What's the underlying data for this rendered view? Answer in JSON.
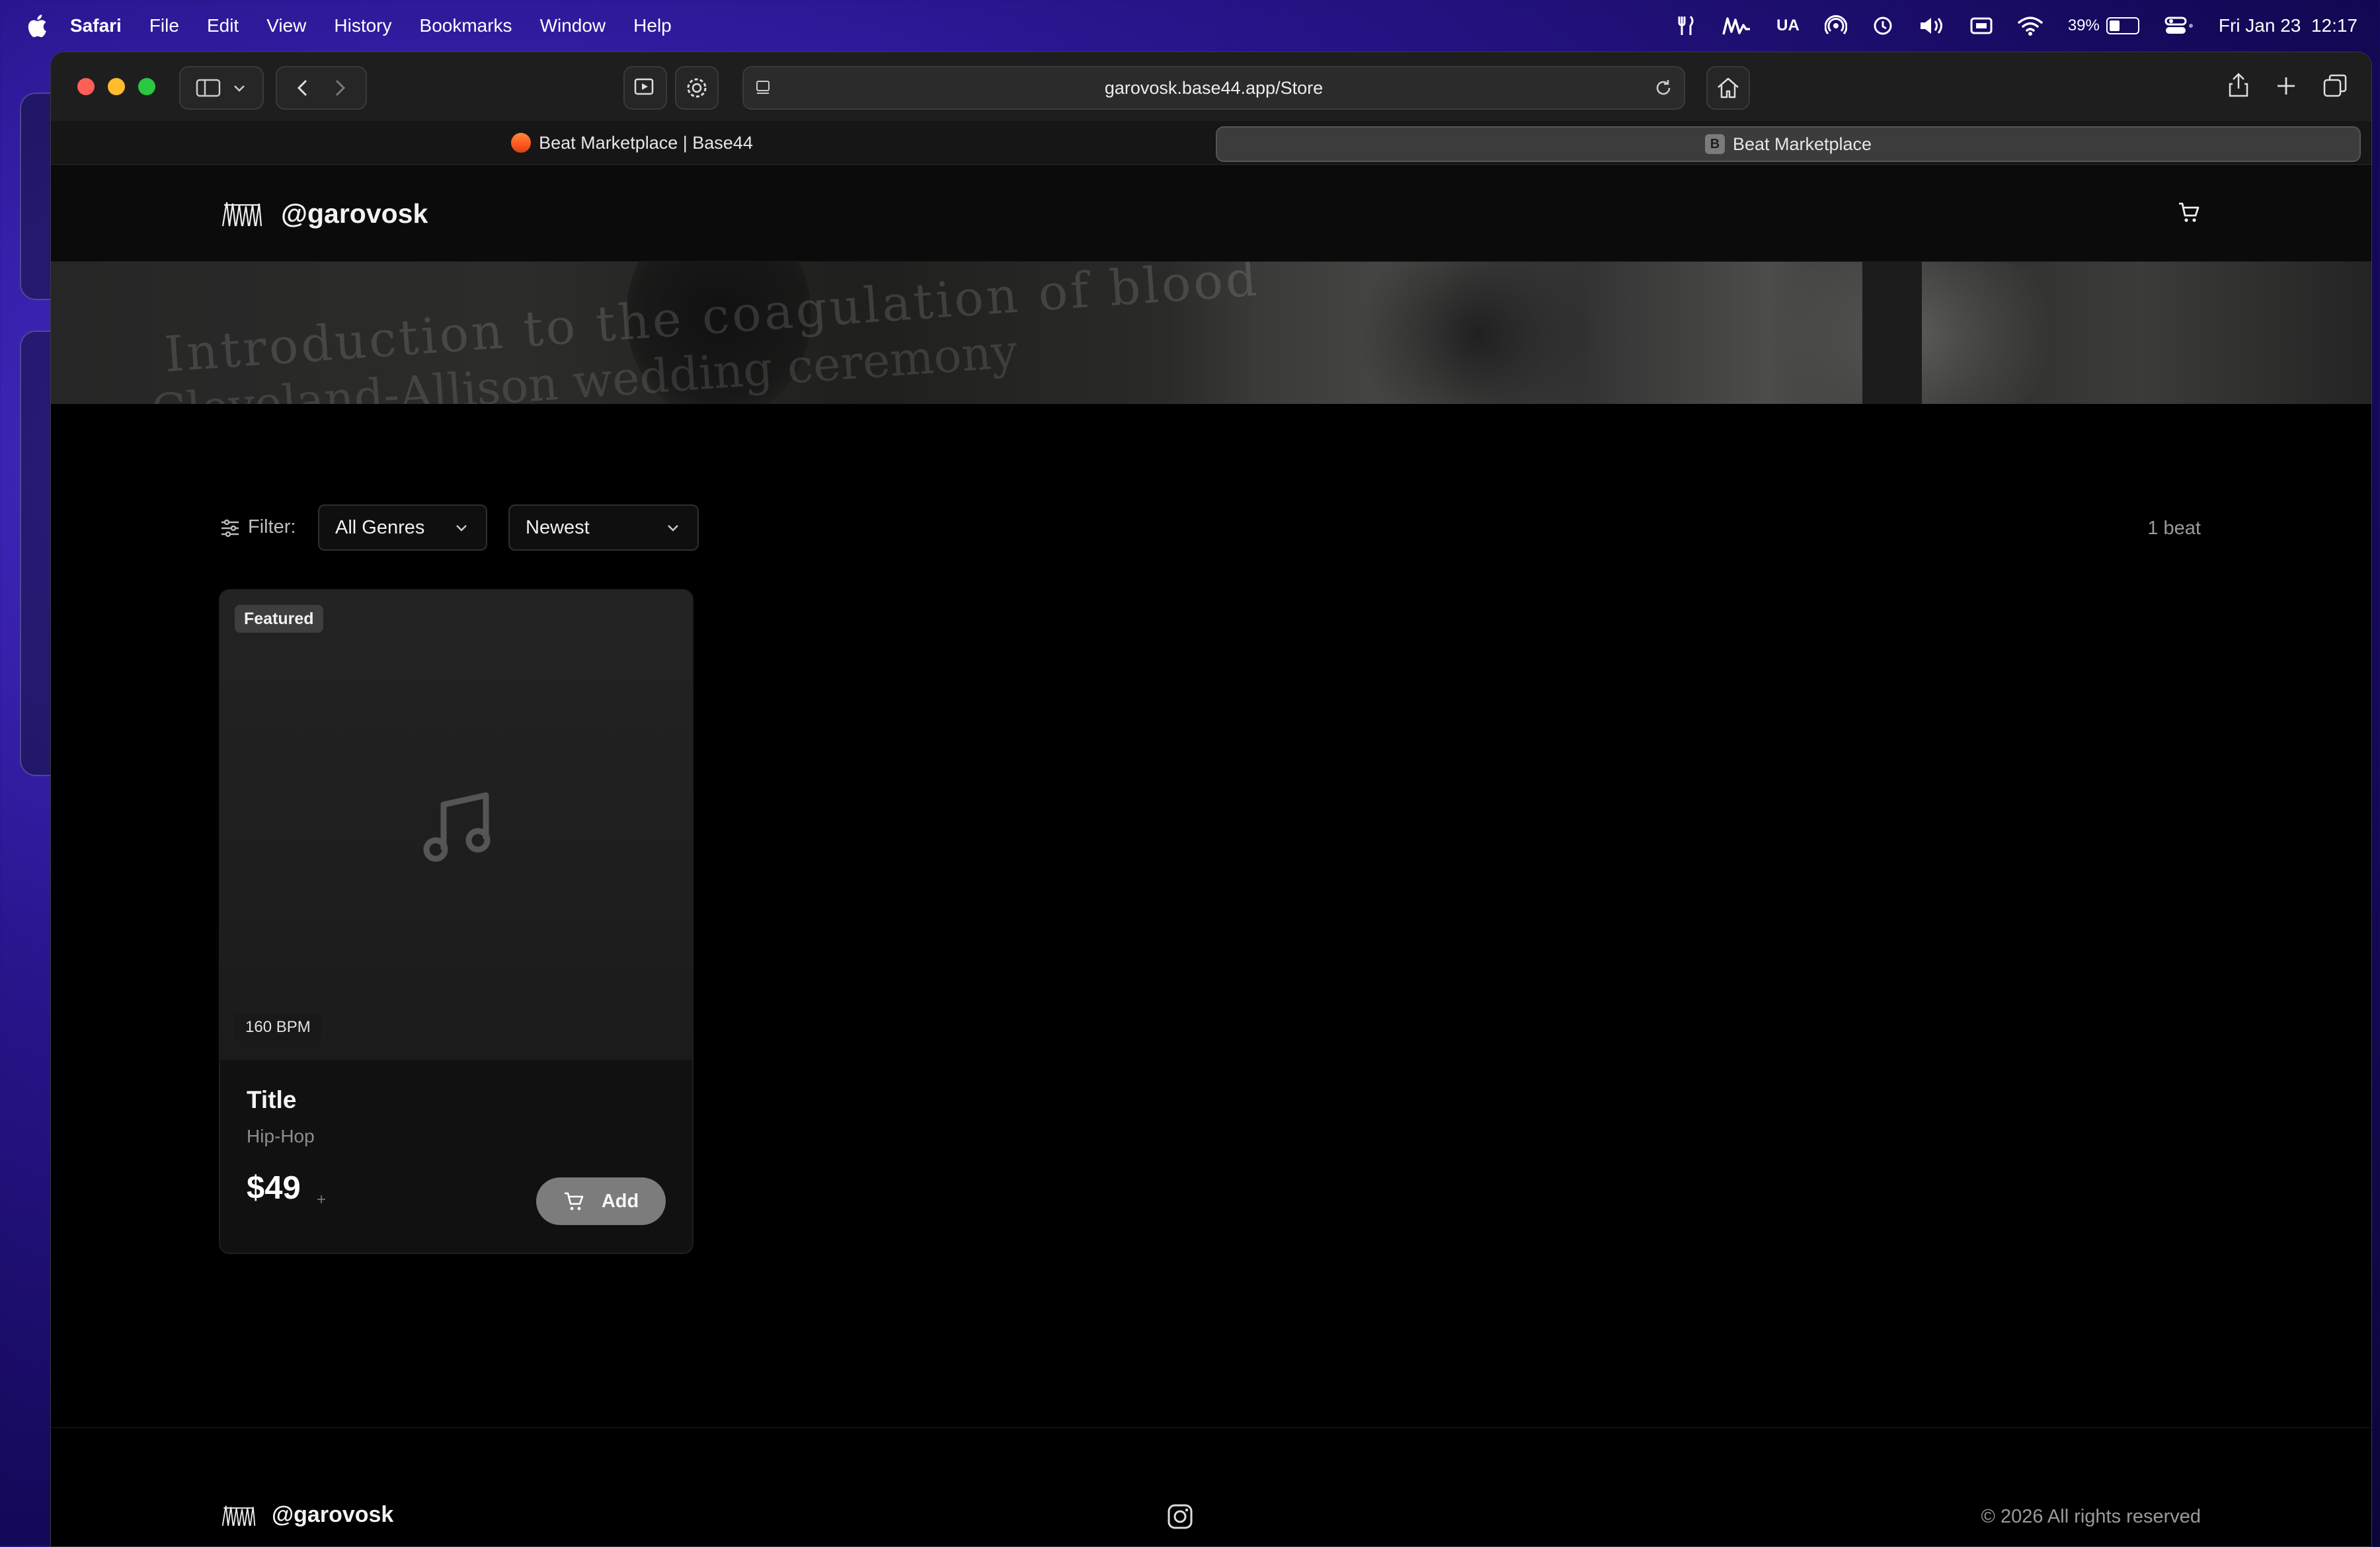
{
  "menubar": {
    "app_name": "Safari",
    "items": [
      "File",
      "Edit",
      "View",
      "History",
      "Bookmarks",
      "Window",
      "Help"
    ],
    "keyboard_layout": "UA",
    "battery_percent": "39%",
    "battery_level": 0.39,
    "datetime": "Fri Jan 23  12:17"
  },
  "browser": {
    "url": "garovosk.base44.app/Store",
    "tabs": [
      {
        "label": "Beat Marketplace | Base44",
        "active": false
      },
      {
        "label": "Beat Marketplace",
        "active": true,
        "favicon_letter": "B"
      }
    ]
  },
  "site": {
    "handle": "@garovosk",
    "hero_text_1": "Introduction to the coagulation of blood",
    "hero_text_2": "Cleveland-Allison wedding ceremony",
    "filter_label": "Filter:",
    "genre_select": "All Genres",
    "sort_select": "Newest",
    "beat_count": "1 beat",
    "beats": [
      {
        "badge": "Featured",
        "bpm": "160 BPM",
        "title": "Title",
        "genre": "Hip-Hop",
        "price": "$49",
        "price_suffix": "+",
        "add_label": "Add"
      }
    ],
    "footer": {
      "handle": "@garovosk",
      "copyright": "© 2026 All rights reserved"
    }
  },
  "icons": {
    "logo": "bridge-logo-icon",
    "cart": "cart-icon",
    "instagram": "instagram-icon",
    "note": "music-note-icon"
  }
}
